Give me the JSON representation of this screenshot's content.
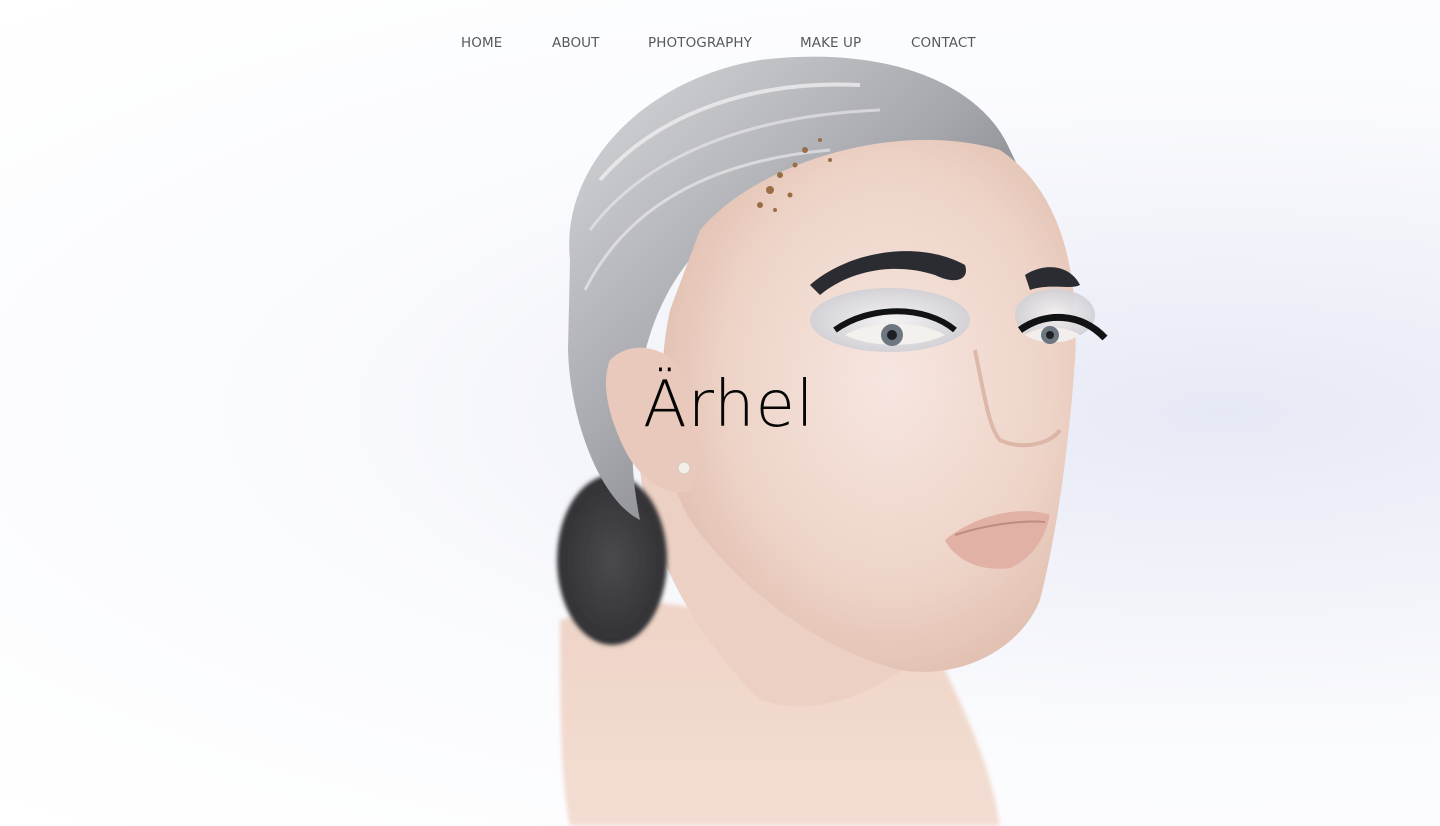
{
  "nav": {
    "items": [
      {
        "label": "HOME"
      },
      {
        "label": "ABOUT"
      },
      {
        "label": "PHOTOGRAPHY"
      },
      {
        "label": "MAKE UP"
      },
      {
        "label": "CONTACT"
      }
    ]
  },
  "hero": {
    "title": "Ärhel",
    "image": "portrait-photo"
  },
  "colors": {
    "nav_text": "#555a60",
    "title_text": "#050505",
    "background": "#f4f5fb"
  }
}
